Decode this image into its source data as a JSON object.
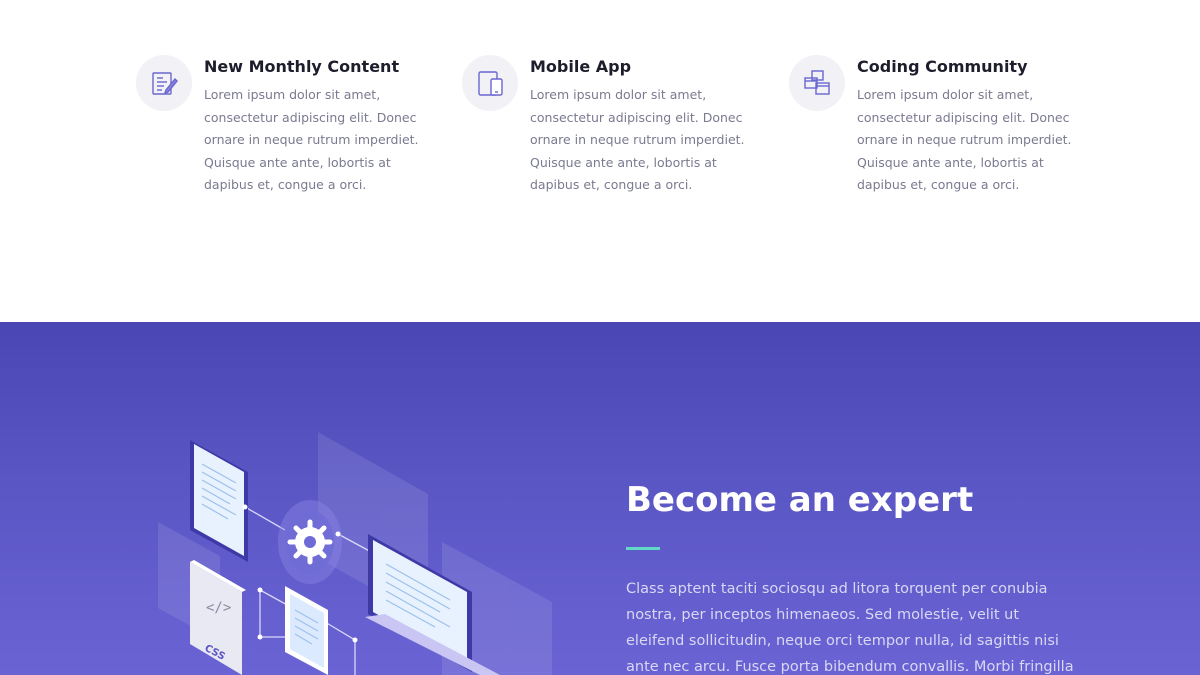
{
  "features": [
    {
      "title": "New Monthly Content",
      "description": "Lorem ipsum dolor sit amet, consectetur adipiscing elit. Donec ornare in neque rutrum imperdiet. Quisque ante ante, lobortis at dapibus et, congue a orci.",
      "icon": "document-edit-icon"
    },
    {
      "title": "Mobile App",
      "description": "Lorem ipsum dolor sit amet, consectetur adipiscing elit. Donec ornare in neque rutrum imperdiet. Quisque ante ante, lobortis at dapibus et, congue a orci.",
      "icon": "mobile-devices-icon"
    },
    {
      "title": "Coding Community",
      "description": "Lorem ipsum dolor sit amet, consectetur adipiscing elit. Donec ornare in neque rutrum imperdiet. Quisque ante ante, lobortis at dapibus et, congue a orci.",
      "icon": "overlapping-windows-icon"
    }
  ],
  "hero": {
    "headline": "Become an expert",
    "body": "Class aptent taciti sociosqu ad litora torquent per conubia nostra, per inceptos himenaeos. Sed molestie, velit ut eleifend sollicitudin, neque orci tempor nulla, id sagittis nisi ante nec arcu. Fusce porta bibendum convallis. Morbi fringilla sollicitudin scelerisque.",
    "illustration": {
      "icon": "isometric-devices-illustration",
      "badge_label": "CSS",
      "code_symbol": "</>"
    }
  },
  "colors": {
    "accent": "#5fd8c4",
    "hero_background": "#5a56c4",
    "icon_stroke": "#6a66d0",
    "heading_text": "#1d1d2c",
    "body_text": "#7a7a90"
  }
}
